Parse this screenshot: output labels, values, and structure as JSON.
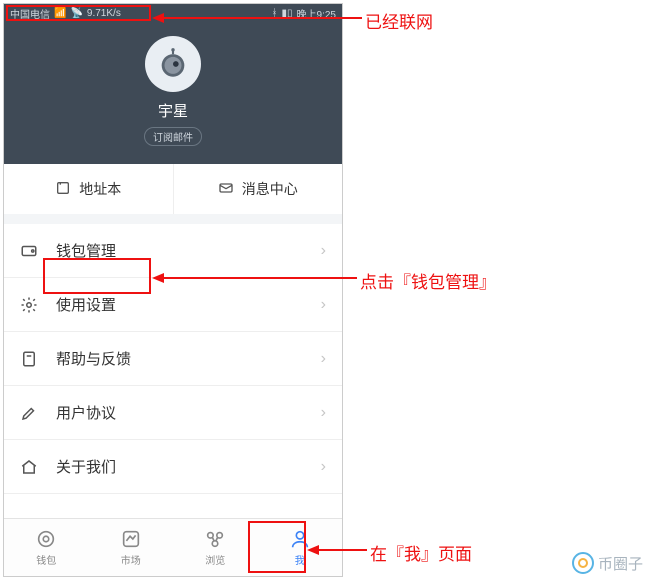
{
  "status": {
    "carrier": "中国电信",
    "speed": "9.71K/s",
    "time": "晚上9:25"
  },
  "profile": {
    "username": "宇星",
    "subscribe_label": "订阅邮件"
  },
  "quick": {
    "address_book": "地址本",
    "message_center": "消息中心"
  },
  "menu": {
    "wallet_manage": "钱包管理",
    "settings": "使用设置",
    "help": "帮助与反馈",
    "agreement": "用户协议",
    "about": "关于我们"
  },
  "tabs": {
    "wallet": "钱包",
    "market": "市场",
    "browse": "浏览",
    "me": "我"
  },
  "annotations": {
    "networked": "已经联网",
    "click_wallet": "点击『钱包管理』",
    "on_me_page": "在『我』页面"
  },
  "watermark": "币圈子"
}
